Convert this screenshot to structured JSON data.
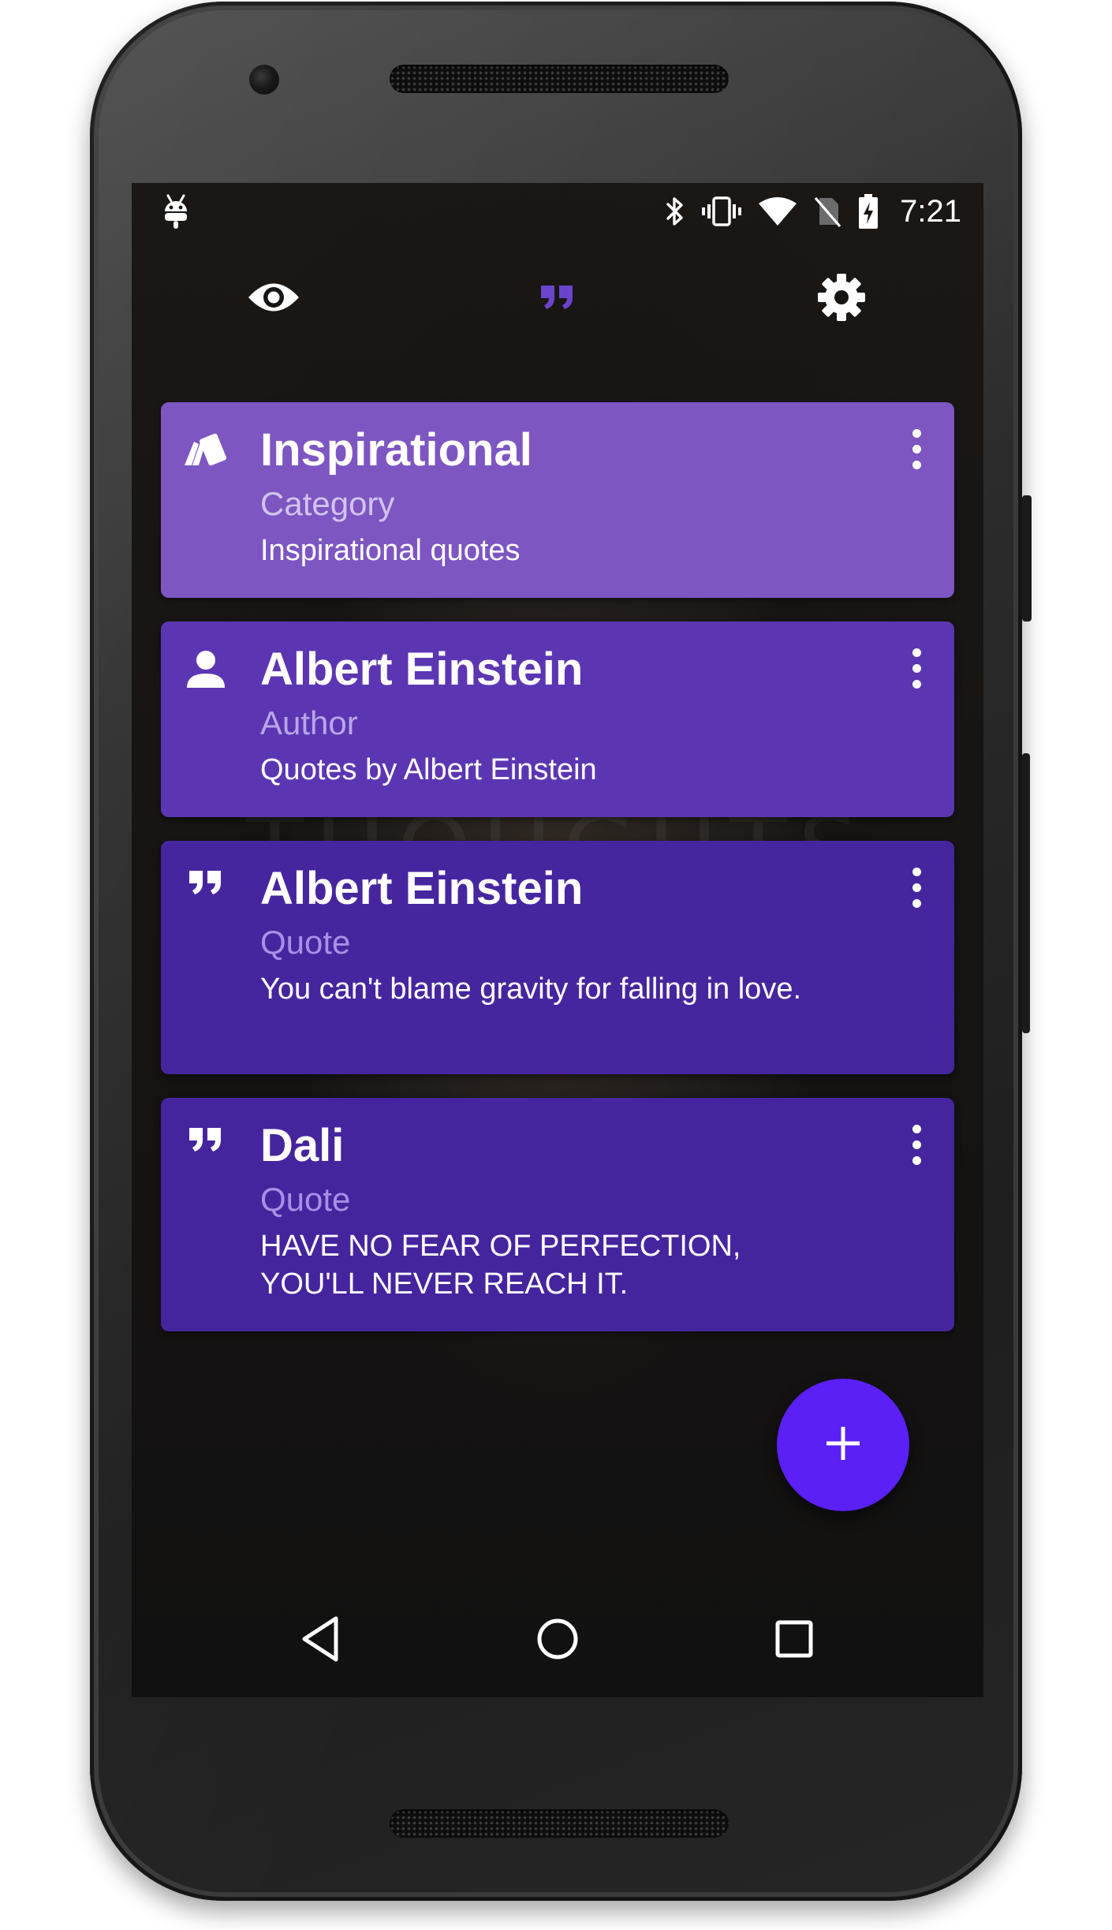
{
  "status_bar": {
    "time": "7:21",
    "left_icon": "android-debug-icon",
    "icons": [
      "bluetooth-icon",
      "vibrate-icon",
      "wifi-icon",
      "no-sim-icon",
      "battery-charging-icon"
    ]
  },
  "tabs": [
    {
      "icon": "eye-icon",
      "selected": false
    },
    {
      "icon": "quotes-icon",
      "selected": true
    },
    {
      "icon": "gear-icon",
      "selected": false
    }
  ],
  "cards": [
    {
      "icon": "category-cards-icon",
      "title": "Inspirational",
      "subtitle": "Category",
      "body": "Inspirational quotes",
      "color": "#7d56c2"
    },
    {
      "icon": "person-icon",
      "title": "Albert Einstein",
      "subtitle": "Author",
      "body": "Quotes by Albert Einstein",
      "color": "#5c36b2"
    },
    {
      "icon": "quote-icon",
      "title": "Albert Einstein",
      "subtitle": "Quote",
      "body": "You can't blame gravity for falling in love.",
      "color": "#46269f"
    },
    {
      "icon": "quote-icon",
      "title": "Dali",
      "subtitle": "Quote",
      "body": "HAVE NO FEAR OF PERFECTION, YOU'LL NEVER REACH IT.",
      "color": "#45259e"
    }
  ],
  "fab": {
    "icon": "plus-icon",
    "color": "#5a20f6"
  },
  "nav_bar": {
    "buttons": [
      "back-icon",
      "home-icon",
      "recents-icon"
    ]
  },
  "colors": {
    "accent": "#6a44cc",
    "fab": "#5a20f6"
  }
}
